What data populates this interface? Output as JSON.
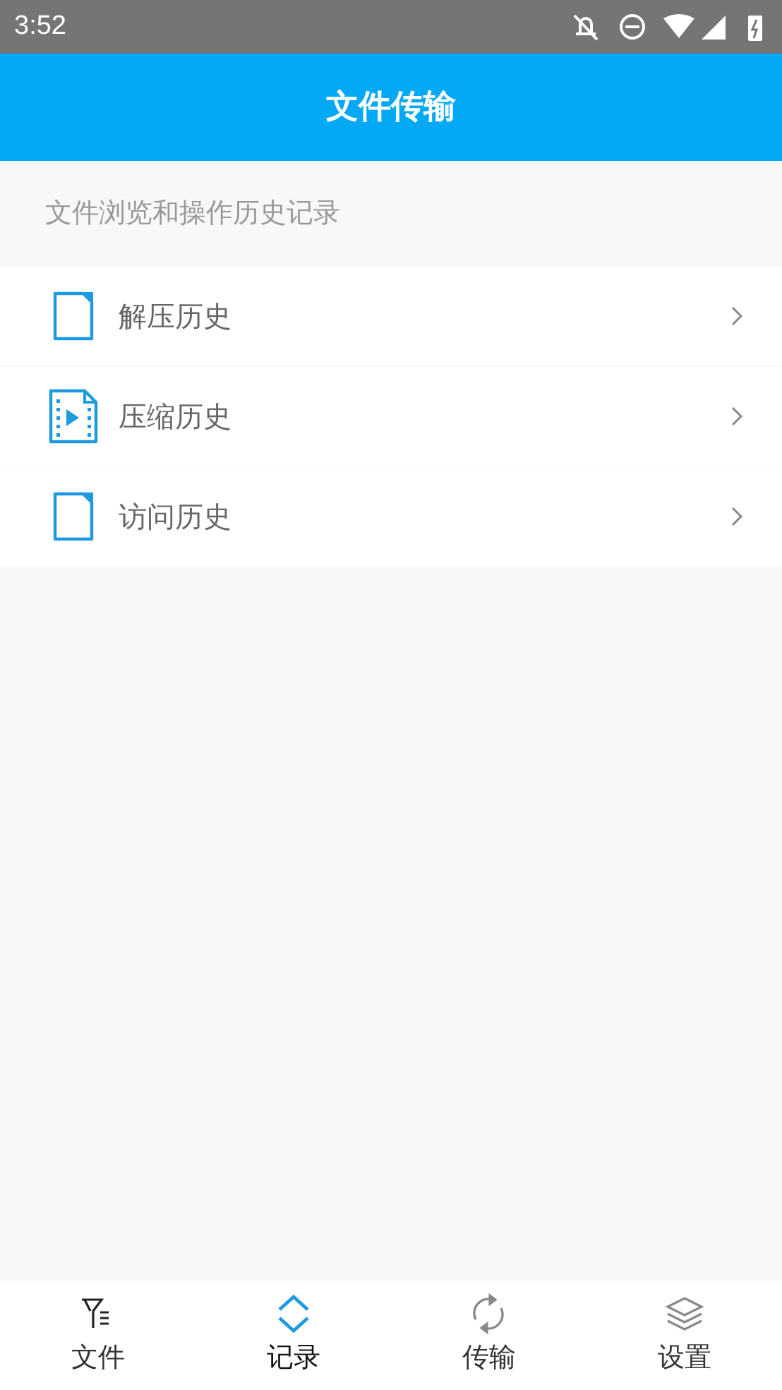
{
  "status_bar": {
    "time": "3:52"
  },
  "header": {
    "title": "文件传输"
  },
  "section": {
    "caption": "文件浏览和操作历史记录"
  },
  "items": [
    {
      "kind": "file",
      "label": "解压历史"
    },
    {
      "kind": "video",
      "label": "压缩历史"
    },
    {
      "kind": "file",
      "label": "访问历史"
    }
  ],
  "tabs": [
    {
      "kind": "filter",
      "label": "文件",
      "selected": false
    },
    {
      "kind": "updown",
      "label": "记录",
      "selected": true
    },
    {
      "kind": "sync",
      "label": "传输",
      "selected": false
    },
    {
      "kind": "layers",
      "label": "设置",
      "selected": false
    }
  ]
}
